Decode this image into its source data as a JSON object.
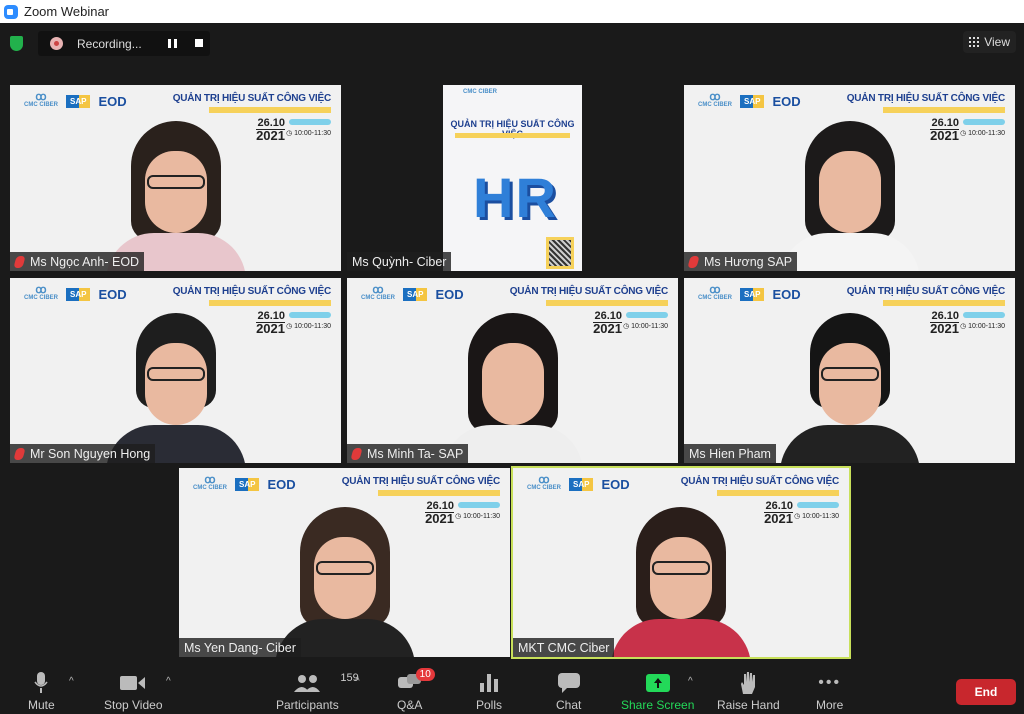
{
  "window": {
    "title": "Zoom Webinar"
  },
  "topbar": {
    "recording_label": "Recording...",
    "view_label": "View"
  },
  "banner": {
    "title": "QUẢN TRỊ HIỆU SUẤT CÔNG VIỆC",
    "day": "26.10",
    "year": "2021",
    "time": "10:00-11:30",
    "logo_cmc": "CMC CIBER",
    "logo_sap": "SAP",
    "logo_eod": "EOD"
  },
  "tiles": [
    {
      "name": "Ms Ngọc Anh- EOD",
      "muted": true
    },
    {
      "name": "Ms Quỳnh- Ciber",
      "muted": false,
      "shared_poster": true,
      "poster_text": "HR"
    },
    {
      "name": "Ms Hương SAP",
      "muted": true
    },
    {
      "name": "Mr Son Nguyen Hong",
      "muted": true
    },
    {
      "name": "Ms Minh Ta- SAP",
      "muted": true
    },
    {
      "name": "Ms Hien Pham",
      "muted": false
    },
    {
      "name": "Ms Yen Dang- Ciber",
      "muted": false
    },
    {
      "name": "MKT CMC Ciber",
      "muted": false,
      "active_speaker": true
    }
  ],
  "toolbar": {
    "mute": "Mute",
    "stop_video": "Stop Video",
    "participants": "Participants",
    "participants_count": "159",
    "qa": "Q&A",
    "qa_badge": "10",
    "polls": "Polls",
    "chat": "Chat",
    "share_screen": "Share Screen",
    "raise_hand": "Raise Hand",
    "more": "More",
    "end": "End"
  },
  "colors": {
    "share_green": "#23d959",
    "end_red": "#c8272d",
    "active_border": "#c8e05a",
    "muted_red": "#e03a3a"
  }
}
